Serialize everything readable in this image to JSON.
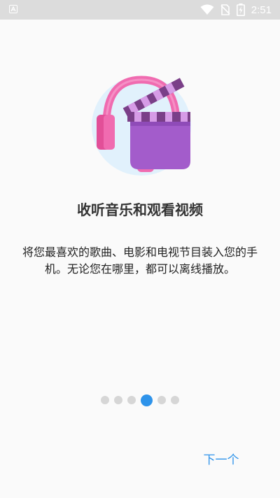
{
  "status_bar": {
    "time": "2:51",
    "icons": [
      "app-notification-icon",
      "wifi-icon",
      "no-sim-icon",
      "battery-charging-icon"
    ]
  },
  "onboarding": {
    "illustration": "headphones-clapperboard-illustration",
    "title": "收听音乐和观看视频",
    "description": "将您最喜欢的歌曲、电影和电视节目装入您的手机。无论您在哪里，都可以离线播放。",
    "page_indicator": {
      "total": 6,
      "current": 4
    },
    "next_label": "下一个"
  },
  "colors": {
    "accent": "#2e93ea",
    "headphones": "#f06bb0",
    "clapper": "#a35ccb",
    "circle": "#e1f1fc"
  }
}
